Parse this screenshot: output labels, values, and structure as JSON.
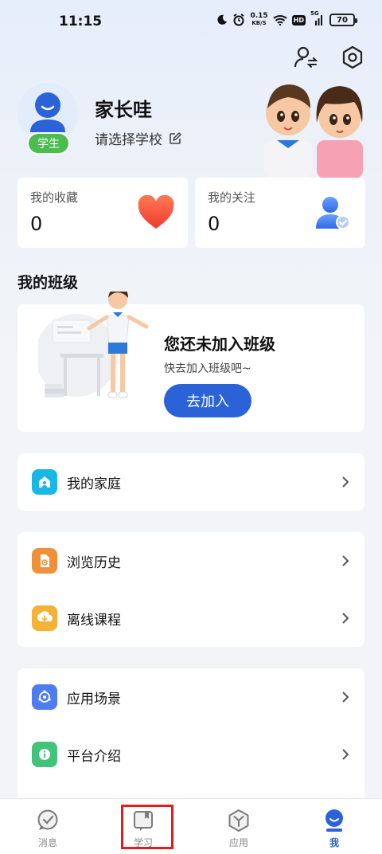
{
  "status_bar": {
    "time": "11:15",
    "speed_value": "0.15",
    "speed_unit": "KB/S",
    "hd": "HD",
    "net": "5G",
    "battery": "70"
  },
  "profile": {
    "name": "家长哇",
    "school_prompt": "请选择学校",
    "role_badge": "学生"
  },
  "stats": {
    "favorites_label": "我的收藏",
    "favorites_count": "0",
    "following_label": "我的关注",
    "following_count": "0"
  },
  "my_class": {
    "section_title": "我的班级",
    "empty_title": "您还未加入班级",
    "empty_subtitle": "快去加入班级吧~",
    "join_button": "去加入"
  },
  "menu": {
    "group1": [
      {
        "label": "我的家庭",
        "icon": "home-icon",
        "color": "#19b7e6"
      }
    ],
    "group2": [
      {
        "label": "浏览历史",
        "icon": "history-icon",
        "color": "#f0903a"
      },
      {
        "label": "离线课程",
        "icon": "download-icon",
        "color": "#f5b236"
      }
    ],
    "group3": [
      {
        "label": "应用场景",
        "icon": "scene-icon",
        "color": "#4e7df2"
      },
      {
        "label": "平台介绍",
        "icon": "info-icon",
        "color": "#43c27a"
      }
    ]
  },
  "bottom_nav": {
    "items": [
      {
        "label": "消息",
        "icon": "message-icon"
      },
      {
        "label": "学习",
        "icon": "study-icon"
      },
      {
        "label": "应用",
        "icon": "apps-icon"
      },
      {
        "label": "我",
        "icon": "profile-icon",
        "active": true
      }
    ]
  },
  "colors": {
    "accent": "#2b62d8",
    "badge_green": "#4bbd4f",
    "highlight_red": "#e31d1d"
  }
}
